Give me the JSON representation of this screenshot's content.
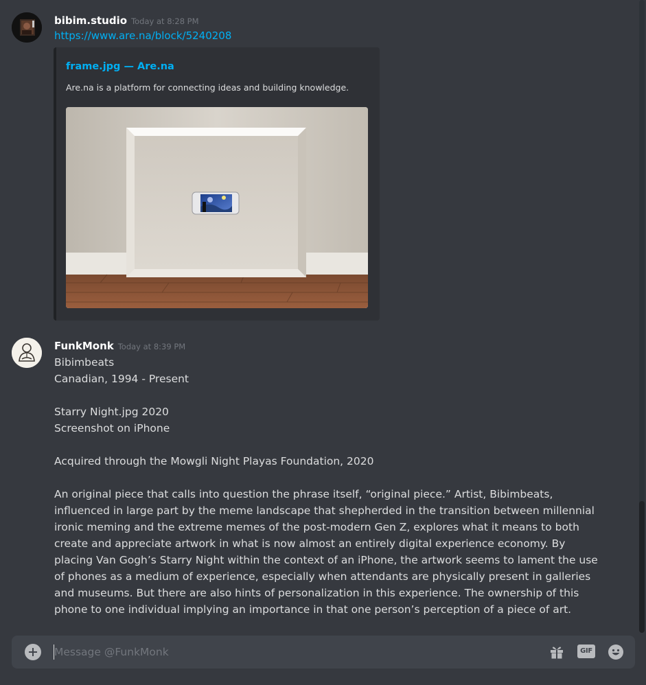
{
  "messages": [
    {
      "username": "bibim.studio",
      "timestamp": "Today at 8:28 PM",
      "link": "https://www.are.na/block/5240208",
      "embed": {
        "title": "frame.jpg — Are.na",
        "description": "Are.na is a platform for connecting ideas and building knowledge."
      }
    },
    {
      "username": "FunkMonk",
      "timestamp": "Today at 8:39 PM",
      "lines": [
        "Bibimbeats",
        "Canadian, 1994 - Present",
        "Starry Night.jpg 2020",
        "Screenshot on iPhone",
        "Acquired through the Mowgli Night Playas Foundation, 2020"
      ],
      "paragraph": "An original piece that calls into question the phrase itself, “original piece.” Artist, Bibimbeats, influenced in large part by the meme landscape that shepherded in the transition between millennial ironic meming and the extreme memes of the post-modern Gen Z, explores what it means to both create and appreciate artwork in what is now almost an entirely digital experience economy. By placing Van Gogh’s Starry Night within the context of an iPhone, the artwork seems to lament the use of phones as a medium of experience, especially when attendants are physically present in galleries and museums. But there are also hints of personalization in this experience. The ownership of this phone to one individual implying an importance in that one person’s perception of a piece of art."
    }
  ],
  "composer": {
    "placeholder": "Message @FunkMonk",
    "gif_label": "GIF",
    "icons": [
      "add-attachment-icon",
      "gift-icon",
      "gif-icon",
      "emoji-icon"
    ]
  },
  "colors": {
    "background": "#36393f",
    "link": "#00b0f4",
    "embed_bg": "#2f3136",
    "input_bg": "#40444b"
  }
}
